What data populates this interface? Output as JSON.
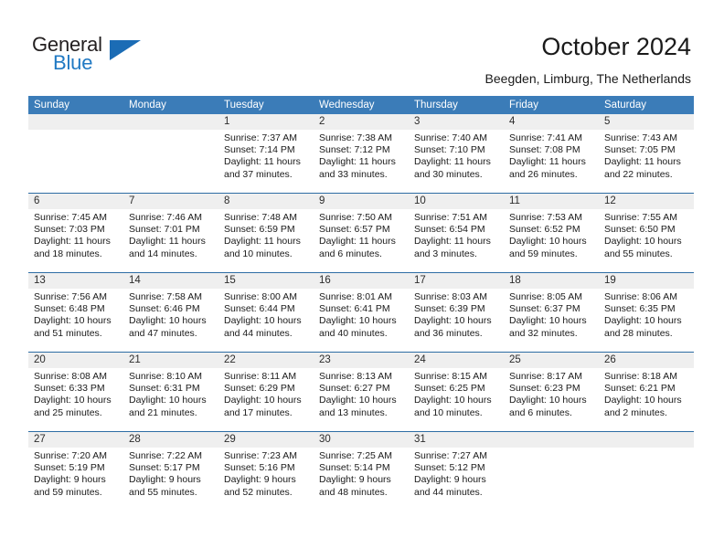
{
  "brand": {
    "name_top": "General",
    "name_bottom": "Blue",
    "color_dark": "#231f20",
    "color_blue": "#2079c3"
  },
  "header": {
    "title": "October 2024",
    "subtitle": "Beegden, Limburg, The Netherlands"
  },
  "theme": {
    "header_bar": "#3b7cb8",
    "row_divider": "#2d6da4",
    "daynum_band": "#efefef",
    "text": "#1a1a1a"
  },
  "weekday_headers": [
    "Sunday",
    "Monday",
    "Tuesday",
    "Wednesday",
    "Thursday",
    "Friday",
    "Saturday"
  ],
  "labels": {
    "sunrise_prefix": "Sunrise:",
    "sunset_prefix": "Sunset:",
    "daylight_prefix": "Daylight:"
  },
  "weeks": [
    [
      {
        "day": ""
      },
      {
        "day": ""
      },
      {
        "day": "1",
        "sunrise": "Sunrise: 7:37 AM",
        "sunset": "Sunset: 7:14 PM",
        "daylight": "Daylight: 11 hours and 37 minutes."
      },
      {
        "day": "2",
        "sunrise": "Sunrise: 7:38 AM",
        "sunset": "Sunset: 7:12 PM",
        "daylight": "Daylight: 11 hours and 33 minutes."
      },
      {
        "day": "3",
        "sunrise": "Sunrise: 7:40 AM",
        "sunset": "Sunset: 7:10 PM",
        "daylight": "Daylight: 11 hours and 30 minutes."
      },
      {
        "day": "4",
        "sunrise": "Sunrise: 7:41 AM",
        "sunset": "Sunset: 7:08 PM",
        "daylight": "Daylight: 11 hours and 26 minutes."
      },
      {
        "day": "5",
        "sunrise": "Sunrise: 7:43 AM",
        "sunset": "Sunset: 7:05 PM",
        "daylight": "Daylight: 11 hours and 22 minutes."
      }
    ],
    [
      {
        "day": "6",
        "sunrise": "Sunrise: 7:45 AM",
        "sunset": "Sunset: 7:03 PM",
        "daylight": "Daylight: 11 hours and 18 minutes."
      },
      {
        "day": "7",
        "sunrise": "Sunrise: 7:46 AM",
        "sunset": "Sunset: 7:01 PM",
        "daylight": "Daylight: 11 hours and 14 minutes."
      },
      {
        "day": "8",
        "sunrise": "Sunrise: 7:48 AM",
        "sunset": "Sunset: 6:59 PM",
        "daylight": "Daylight: 11 hours and 10 minutes."
      },
      {
        "day": "9",
        "sunrise": "Sunrise: 7:50 AM",
        "sunset": "Sunset: 6:57 PM",
        "daylight": "Daylight: 11 hours and 6 minutes."
      },
      {
        "day": "10",
        "sunrise": "Sunrise: 7:51 AM",
        "sunset": "Sunset: 6:54 PM",
        "daylight": "Daylight: 11 hours and 3 minutes."
      },
      {
        "day": "11",
        "sunrise": "Sunrise: 7:53 AM",
        "sunset": "Sunset: 6:52 PM",
        "daylight": "Daylight: 10 hours and 59 minutes."
      },
      {
        "day": "12",
        "sunrise": "Sunrise: 7:55 AM",
        "sunset": "Sunset: 6:50 PM",
        "daylight": "Daylight: 10 hours and 55 minutes."
      }
    ],
    [
      {
        "day": "13",
        "sunrise": "Sunrise: 7:56 AM",
        "sunset": "Sunset: 6:48 PM",
        "daylight": "Daylight: 10 hours and 51 minutes."
      },
      {
        "day": "14",
        "sunrise": "Sunrise: 7:58 AM",
        "sunset": "Sunset: 6:46 PM",
        "daylight": "Daylight: 10 hours and 47 minutes."
      },
      {
        "day": "15",
        "sunrise": "Sunrise: 8:00 AM",
        "sunset": "Sunset: 6:44 PM",
        "daylight": "Daylight: 10 hours and 44 minutes."
      },
      {
        "day": "16",
        "sunrise": "Sunrise: 8:01 AM",
        "sunset": "Sunset: 6:41 PM",
        "daylight": "Daylight: 10 hours and 40 minutes."
      },
      {
        "day": "17",
        "sunrise": "Sunrise: 8:03 AM",
        "sunset": "Sunset: 6:39 PM",
        "daylight": "Daylight: 10 hours and 36 minutes."
      },
      {
        "day": "18",
        "sunrise": "Sunrise: 8:05 AM",
        "sunset": "Sunset: 6:37 PM",
        "daylight": "Daylight: 10 hours and 32 minutes."
      },
      {
        "day": "19",
        "sunrise": "Sunrise: 8:06 AM",
        "sunset": "Sunset: 6:35 PM",
        "daylight": "Daylight: 10 hours and 28 minutes."
      }
    ],
    [
      {
        "day": "20",
        "sunrise": "Sunrise: 8:08 AM",
        "sunset": "Sunset: 6:33 PM",
        "daylight": "Daylight: 10 hours and 25 minutes."
      },
      {
        "day": "21",
        "sunrise": "Sunrise: 8:10 AM",
        "sunset": "Sunset: 6:31 PM",
        "daylight": "Daylight: 10 hours and 21 minutes."
      },
      {
        "day": "22",
        "sunrise": "Sunrise: 8:11 AM",
        "sunset": "Sunset: 6:29 PM",
        "daylight": "Daylight: 10 hours and 17 minutes."
      },
      {
        "day": "23",
        "sunrise": "Sunrise: 8:13 AM",
        "sunset": "Sunset: 6:27 PM",
        "daylight": "Daylight: 10 hours and 13 minutes."
      },
      {
        "day": "24",
        "sunrise": "Sunrise: 8:15 AM",
        "sunset": "Sunset: 6:25 PM",
        "daylight": "Daylight: 10 hours and 10 minutes."
      },
      {
        "day": "25",
        "sunrise": "Sunrise: 8:17 AM",
        "sunset": "Sunset: 6:23 PM",
        "daylight": "Daylight: 10 hours and 6 minutes."
      },
      {
        "day": "26",
        "sunrise": "Sunrise: 8:18 AM",
        "sunset": "Sunset: 6:21 PM",
        "daylight": "Daylight: 10 hours and 2 minutes."
      }
    ],
    [
      {
        "day": "27",
        "sunrise": "Sunrise: 7:20 AM",
        "sunset": "Sunset: 5:19 PM",
        "daylight": "Daylight: 9 hours and 59 minutes."
      },
      {
        "day": "28",
        "sunrise": "Sunrise: 7:22 AM",
        "sunset": "Sunset: 5:17 PM",
        "daylight": "Daylight: 9 hours and 55 minutes."
      },
      {
        "day": "29",
        "sunrise": "Sunrise: 7:23 AM",
        "sunset": "Sunset: 5:16 PM",
        "daylight": "Daylight: 9 hours and 52 minutes."
      },
      {
        "day": "30",
        "sunrise": "Sunrise: 7:25 AM",
        "sunset": "Sunset: 5:14 PM",
        "daylight": "Daylight: 9 hours and 48 minutes."
      },
      {
        "day": "31",
        "sunrise": "Sunrise: 7:27 AM",
        "sunset": "Sunset: 5:12 PM",
        "daylight": "Daylight: 9 hours and 44 minutes."
      },
      {
        "day": ""
      },
      {
        "day": ""
      }
    ]
  ]
}
